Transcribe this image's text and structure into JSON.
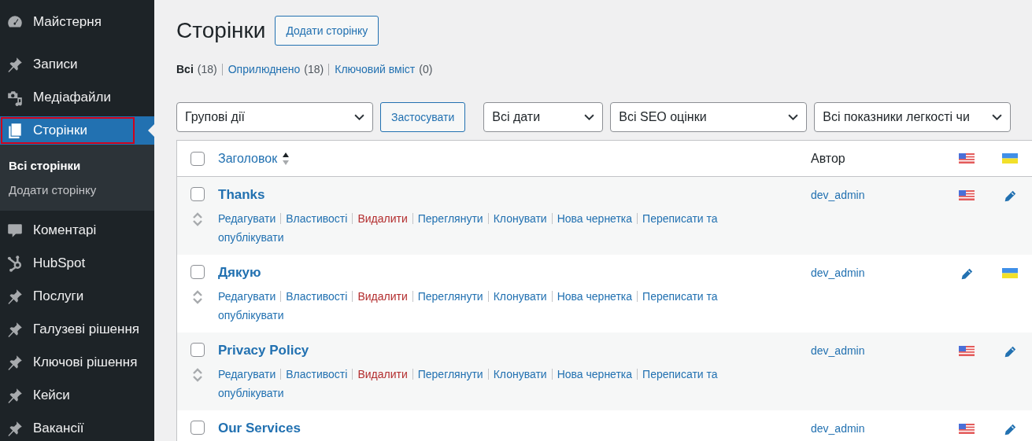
{
  "sidebar": {
    "items": [
      {
        "label": "Майстерня",
        "kind": "dashboard",
        "selected": false
      },
      {
        "label": "Записи",
        "kind": "pin",
        "selected": false
      },
      {
        "label": "Медіафайли",
        "kind": "media",
        "selected": false
      },
      {
        "label": "Сторінки",
        "kind": "pages",
        "selected": true,
        "children": [
          {
            "label": "Всі сторінки",
            "selected": true
          },
          {
            "label": "Додати сторінку",
            "selected": false
          }
        ]
      },
      {
        "label": "Коментарі",
        "kind": "comments",
        "selected": false
      },
      {
        "label": "HubSpot",
        "kind": "hubspot",
        "selected": false
      },
      {
        "label": "Послуги",
        "kind": "pin",
        "selected": false
      },
      {
        "label": "Галузеві рішення",
        "kind": "pin",
        "selected": false
      },
      {
        "label": "Ключові рішення",
        "kind": "pin",
        "selected": false
      },
      {
        "label": "Кейси",
        "kind": "pin",
        "selected": false
      },
      {
        "label": "Вакансії",
        "kind": "pin",
        "selected": false
      }
    ]
  },
  "page": {
    "title": "Сторінки",
    "add_button": "Додати сторінку"
  },
  "views": [
    {
      "label": "Всі",
      "count": "(18)",
      "selected": true
    },
    {
      "label": "Оприлюднено",
      "count": "(18)",
      "selected": false
    },
    {
      "label": "Ключовий вміст",
      "count": "(0)",
      "selected": false
    }
  ],
  "filters": {
    "bulk_action": "Групові дії",
    "apply": "Застосувати",
    "dates": "Всі дати",
    "seo": "Всі SEO оцінки",
    "readability": "Всі показники легкості чи"
  },
  "table": {
    "select_all": {
      "checked": false
    },
    "columns": [
      {
        "label": "Заголовок",
        "sort_ascending": true
      },
      {
        "label": "Автор"
      },
      {
        "kind": "flag-us"
      },
      {
        "kind": "flag-ua"
      }
    ],
    "rows": [
      {
        "title": "Thanks",
        "checked": false,
        "author": "dev_admin",
        "languages": [
          {
            "kind": "flag-us"
          },
          {
            "kind": "edit"
          }
        ],
        "actions": [
          {
            "label": "Редагувати",
            "kind": "link"
          },
          {
            "label": "Властивості",
            "kind": "link"
          },
          {
            "label": "Видалити",
            "kind": "delete"
          },
          {
            "label": "Переглянути",
            "kind": "link"
          },
          {
            "label": "Клонувати",
            "kind": "link"
          },
          {
            "label": "Нова чернетка",
            "kind": "link"
          },
          {
            "label": "Переписати та опублікувати",
            "kind": "link"
          }
        ]
      },
      {
        "title": "Дякую",
        "checked": false,
        "author": "dev_admin",
        "languages": [
          {
            "kind": "edit"
          },
          {
            "kind": "flag-ua"
          }
        ],
        "actions": [
          {
            "label": "Редагувати",
            "kind": "link"
          },
          {
            "label": "Властивості",
            "kind": "link"
          },
          {
            "label": "Видалити",
            "kind": "delete"
          },
          {
            "label": "Переглянути",
            "kind": "link"
          },
          {
            "label": "Клонувати",
            "kind": "link"
          },
          {
            "label": "Нова чернетка",
            "kind": "link"
          },
          {
            "label": "Переписати та опублікувати",
            "kind": "link"
          }
        ]
      },
      {
        "title": "Privacy Policy",
        "checked": false,
        "author": "dev_admin",
        "languages": [
          {
            "kind": "flag-us"
          },
          {
            "kind": "edit"
          }
        ],
        "actions": [
          {
            "label": "Редагувати",
            "kind": "link"
          },
          {
            "label": "Властивості",
            "kind": "link"
          },
          {
            "label": "Видалити",
            "kind": "delete"
          },
          {
            "label": "Переглянути",
            "kind": "link"
          },
          {
            "label": "Клонувати",
            "kind": "link"
          },
          {
            "label": "Нова чернетка",
            "kind": "link"
          },
          {
            "label": "Переписати та опублікувати",
            "kind": "link"
          }
        ]
      },
      {
        "title": "Our Services",
        "checked": false,
        "author": "dev_admin",
        "languages": [
          {
            "kind": "flag-us"
          },
          {
            "kind": "edit"
          }
        ]
      }
    ]
  }
}
